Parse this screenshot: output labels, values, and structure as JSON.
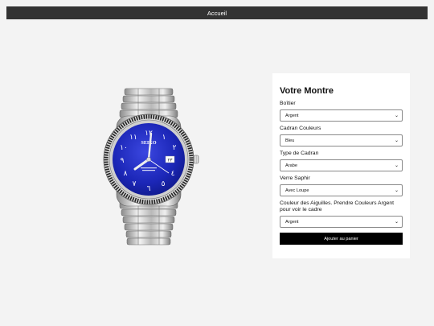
{
  "navbar": {
    "home_label": "Accueil"
  },
  "product": {
    "image_alt": "SEIKO",
    "dial_brand": "SEIKO",
    "dial_color": "#1c27b8"
  },
  "panel": {
    "title": "Votre Montre",
    "fields": [
      {
        "label": "Boîtier",
        "value": "Argent"
      },
      {
        "label": "Cadran Couleurs",
        "value": "Bleu"
      },
      {
        "label": "Type de Cadran",
        "value": "Arabe"
      },
      {
        "label": "Verre Saphir",
        "value": "Avec Loupe"
      },
      {
        "label": "Couleur des Aiguilles. Prendre Couleurs Argent pour voir le cadre",
        "value": "Argent"
      }
    ],
    "add_to_cart_label": "Ajouter au panier"
  }
}
